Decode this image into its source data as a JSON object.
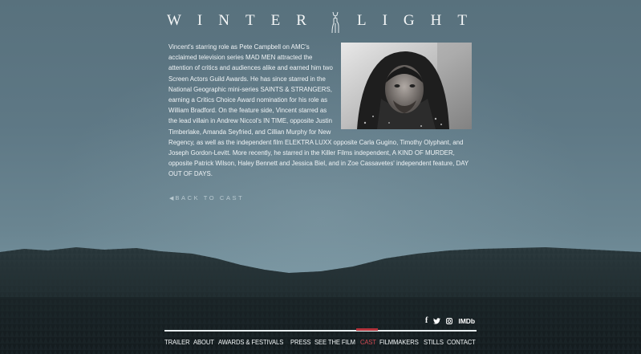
{
  "site": {
    "logo_left": "WINTER",
    "logo_right": "LIGHT"
  },
  "bio": {
    "text": "Vincent's starring role as Pete Campbell on AMC's acclaimed television series MAD MEN attracted the attention of critics and audiences alike and earned him two Screen Actors Guild Awards. He has since starred in the National Geographic mini-series SAINTS & STRANGERS, earning a Critics Choice Award nomination for his role as William Bradford. On the feature side, Vincent starred as the lead villain in Andrew Niccol's IN TIME, opposite Justin Timberlake, Amanda Seyfried, and Cillian Murphy for New Regency, as well as the independent film ELEKTRA LUXX opposite Carla Gugino, Timothy Olyphant, and Joseph Gordon-Levitt. More recently, he starred in the Killer Films independent, A KIND OF MURDER, opposite Patrick Wilson, Haley Bennett and Jessica Biel, and in Zoe Cassavetes' independent feature, DAY OUT OF DAYS."
  },
  "back_link": {
    "arrow": "◀",
    "label": "BACK TO CAST"
  },
  "social": {
    "facebook": "f",
    "twitter": "🐦",
    "instagram": "◘",
    "imdb": "IMDb"
  },
  "nav": {
    "items": [
      {
        "label": "TRAILER"
      },
      {
        "label": "ABOUT"
      },
      {
        "label": "AWARDS & FESTIVALS"
      },
      {
        "label": "PRESS"
      },
      {
        "label": "SEE THE FILM"
      },
      {
        "label": "CAST"
      },
      {
        "label": "FILMMAKERS"
      },
      {
        "label": "STILLS"
      },
      {
        "label": "CONTACT"
      }
    ],
    "active": "CAST"
  },
  "colors": {
    "accent": "#b5333c",
    "background": "#5e7885",
    "forest": "#1f2b2e"
  }
}
